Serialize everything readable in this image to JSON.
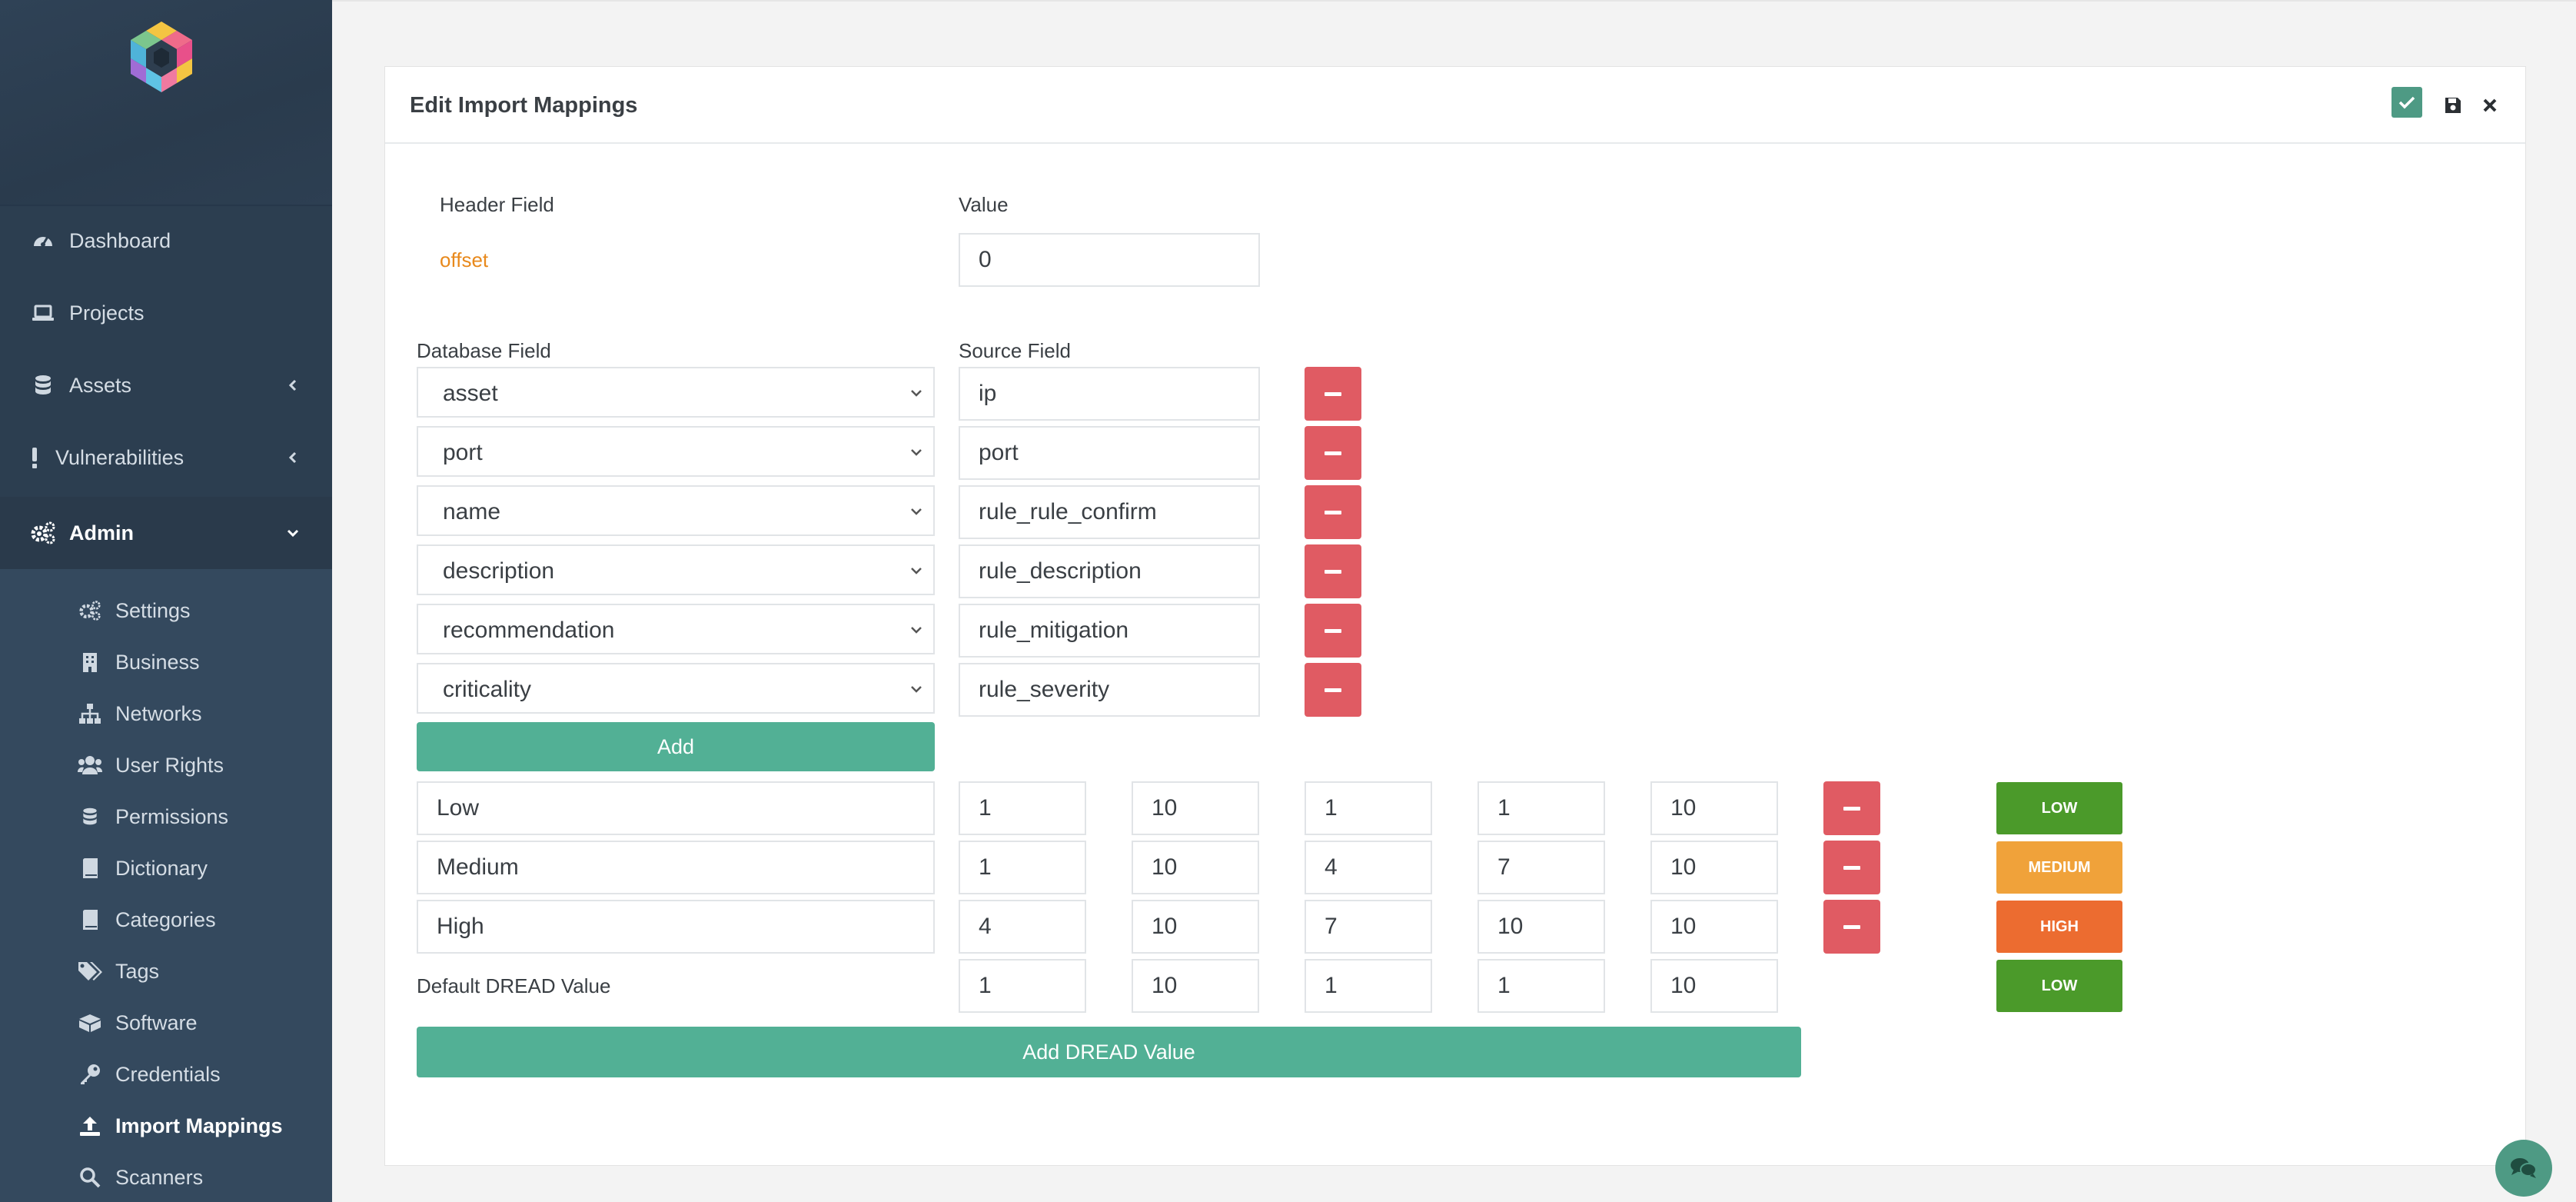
{
  "colors": {
    "sidebar_bg": "#2c3e50",
    "accent_green": "#52b095",
    "danger_red": "#e05b63",
    "low": "#4b9a2a",
    "medium": "#f0a23a",
    "high": "#ec6c30",
    "header_field_value": "#e8891c"
  },
  "sidebar": {
    "items": [
      {
        "label": "Dashboard",
        "icon": "dashboard-icon"
      },
      {
        "label": "Projects",
        "icon": "laptop-icon"
      },
      {
        "label": "Assets",
        "icon": "database-icon"
      },
      {
        "label": "Vulnerabilities",
        "icon": "exclamation-icon"
      },
      {
        "label": "Admin",
        "icon": "cogs-icon"
      }
    ],
    "admin_items": [
      {
        "label": "Settings",
        "icon": "cogs-icon"
      },
      {
        "label": "Business",
        "icon": "building-icon"
      },
      {
        "label": "Networks",
        "icon": "sitemap-icon"
      },
      {
        "label": "User Rights",
        "icon": "users-icon"
      },
      {
        "label": "Permissions",
        "icon": "database-icon"
      },
      {
        "label": "Dictionary",
        "icon": "book-icon"
      },
      {
        "label": "Categories",
        "icon": "book-icon"
      },
      {
        "label": "Tags",
        "icon": "tags-icon"
      },
      {
        "label": "Software",
        "icon": "boxes-icon"
      },
      {
        "label": "Credentials",
        "icon": "key-icon"
      },
      {
        "label": "Import Mappings",
        "icon": "upload-icon"
      },
      {
        "label": "Scanners",
        "icon": "search-icon"
      }
    ],
    "active_item": "Import Mappings"
  },
  "panel": {
    "title": "Edit Import Mappings",
    "header_field_label": "Header Field",
    "value_label": "Value",
    "header_field_value": "offset",
    "offset_value": "0",
    "database_field_label": "Database Field",
    "source_field_label": "Source Field",
    "mappings": [
      {
        "db": "asset",
        "source": "ip"
      },
      {
        "db": "port",
        "source": "port"
      },
      {
        "db": "name",
        "source": "rule_rule_confirm"
      },
      {
        "db": "description",
        "source": "rule_description"
      },
      {
        "db": "recommendation",
        "source": "rule_mitigation"
      },
      {
        "db": "criticality",
        "source": "rule_severity"
      }
    ],
    "add_label": "Add",
    "dread_rows": [
      {
        "name": "Low",
        "values": [
          "1",
          "10",
          "1",
          "1",
          "10"
        ],
        "badge": "LOW"
      },
      {
        "name": "Medium",
        "values": [
          "1",
          "10",
          "4",
          "7",
          "10"
        ],
        "badge": "MEDIUM"
      },
      {
        "name": "High",
        "values": [
          "4",
          "10",
          "7",
          "10",
          "10"
        ],
        "badge": "HIGH"
      }
    ],
    "default_dread_label": "Default DREAD Value",
    "default_dread_values": [
      "1",
      "10",
      "1",
      "1",
      "10"
    ],
    "default_dread_badge": "LOW",
    "add_dread_label": "Add DREAD Value"
  }
}
